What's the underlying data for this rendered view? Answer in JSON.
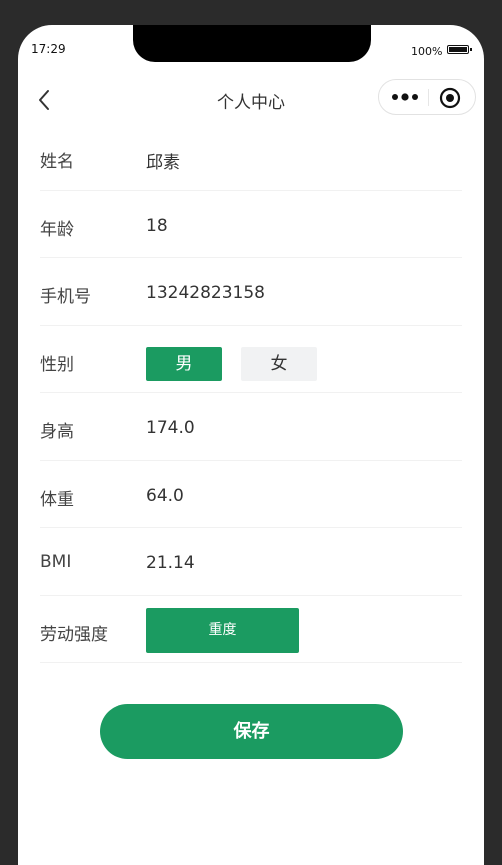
{
  "status_bar": {
    "time": "17:29",
    "battery": "100%"
  },
  "nav": {
    "title": "个人中心"
  },
  "form": {
    "name": {
      "label": "姓名",
      "value": "邱素"
    },
    "age": {
      "label": "年龄",
      "value": "18"
    },
    "phone": {
      "label": "手机号",
      "value": "13242823158"
    },
    "gender": {
      "label": "性别",
      "options": [
        "男",
        "女"
      ],
      "selected": "男"
    },
    "height": {
      "label": "身高",
      "value": "174.0"
    },
    "weight": {
      "label": "体重",
      "value": "64.0"
    },
    "bmi": {
      "label": "BMI",
      "value": "21.14"
    },
    "labor": {
      "label": "劳动强度",
      "value": "重度"
    }
  },
  "save_label": "保存",
  "colors": {
    "accent": "#1b9b61",
    "unselected_bg": "#f1f2f3",
    "frame_bg": "#2b2b2b"
  },
  "icons": {
    "back": "chevron-left-icon",
    "more": "more-dots-icon",
    "record": "record-icon",
    "battery": "battery-icon"
  }
}
